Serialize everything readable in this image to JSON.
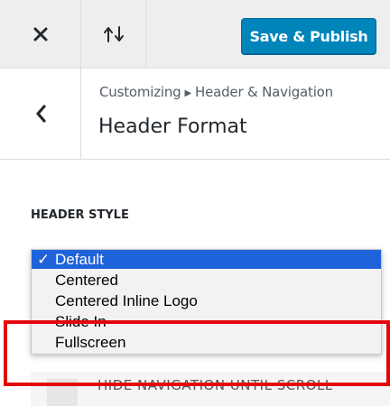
{
  "toolbar": {
    "close_icon": "close-icon",
    "sort_icon": "reorder-arrows-icon",
    "save_label": "Save & Publish",
    "accent": "#0085ba"
  },
  "section": {
    "back_icon": "chevron-left-icon",
    "breadcrumb_root": "Customizing",
    "breadcrumb_separator": "▶",
    "breadcrumb_current": "Header & Navigation",
    "title": "Header Format"
  },
  "header_style": {
    "label": "Header Style",
    "selected": "Default",
    "check_mark": "✓",
    "options": [
      "Default",
      "Centered",
      "Centered Inline Logo",
      "Slide In",
      "Fullscreen"
    ],
    "selection_color": "#1f63da"
  },
  "next_control": {
    "label": "Hide Navigation Until Scroll"
  },
  "annotation": {
    "highlight_color": "#e3070b"
  }
}
